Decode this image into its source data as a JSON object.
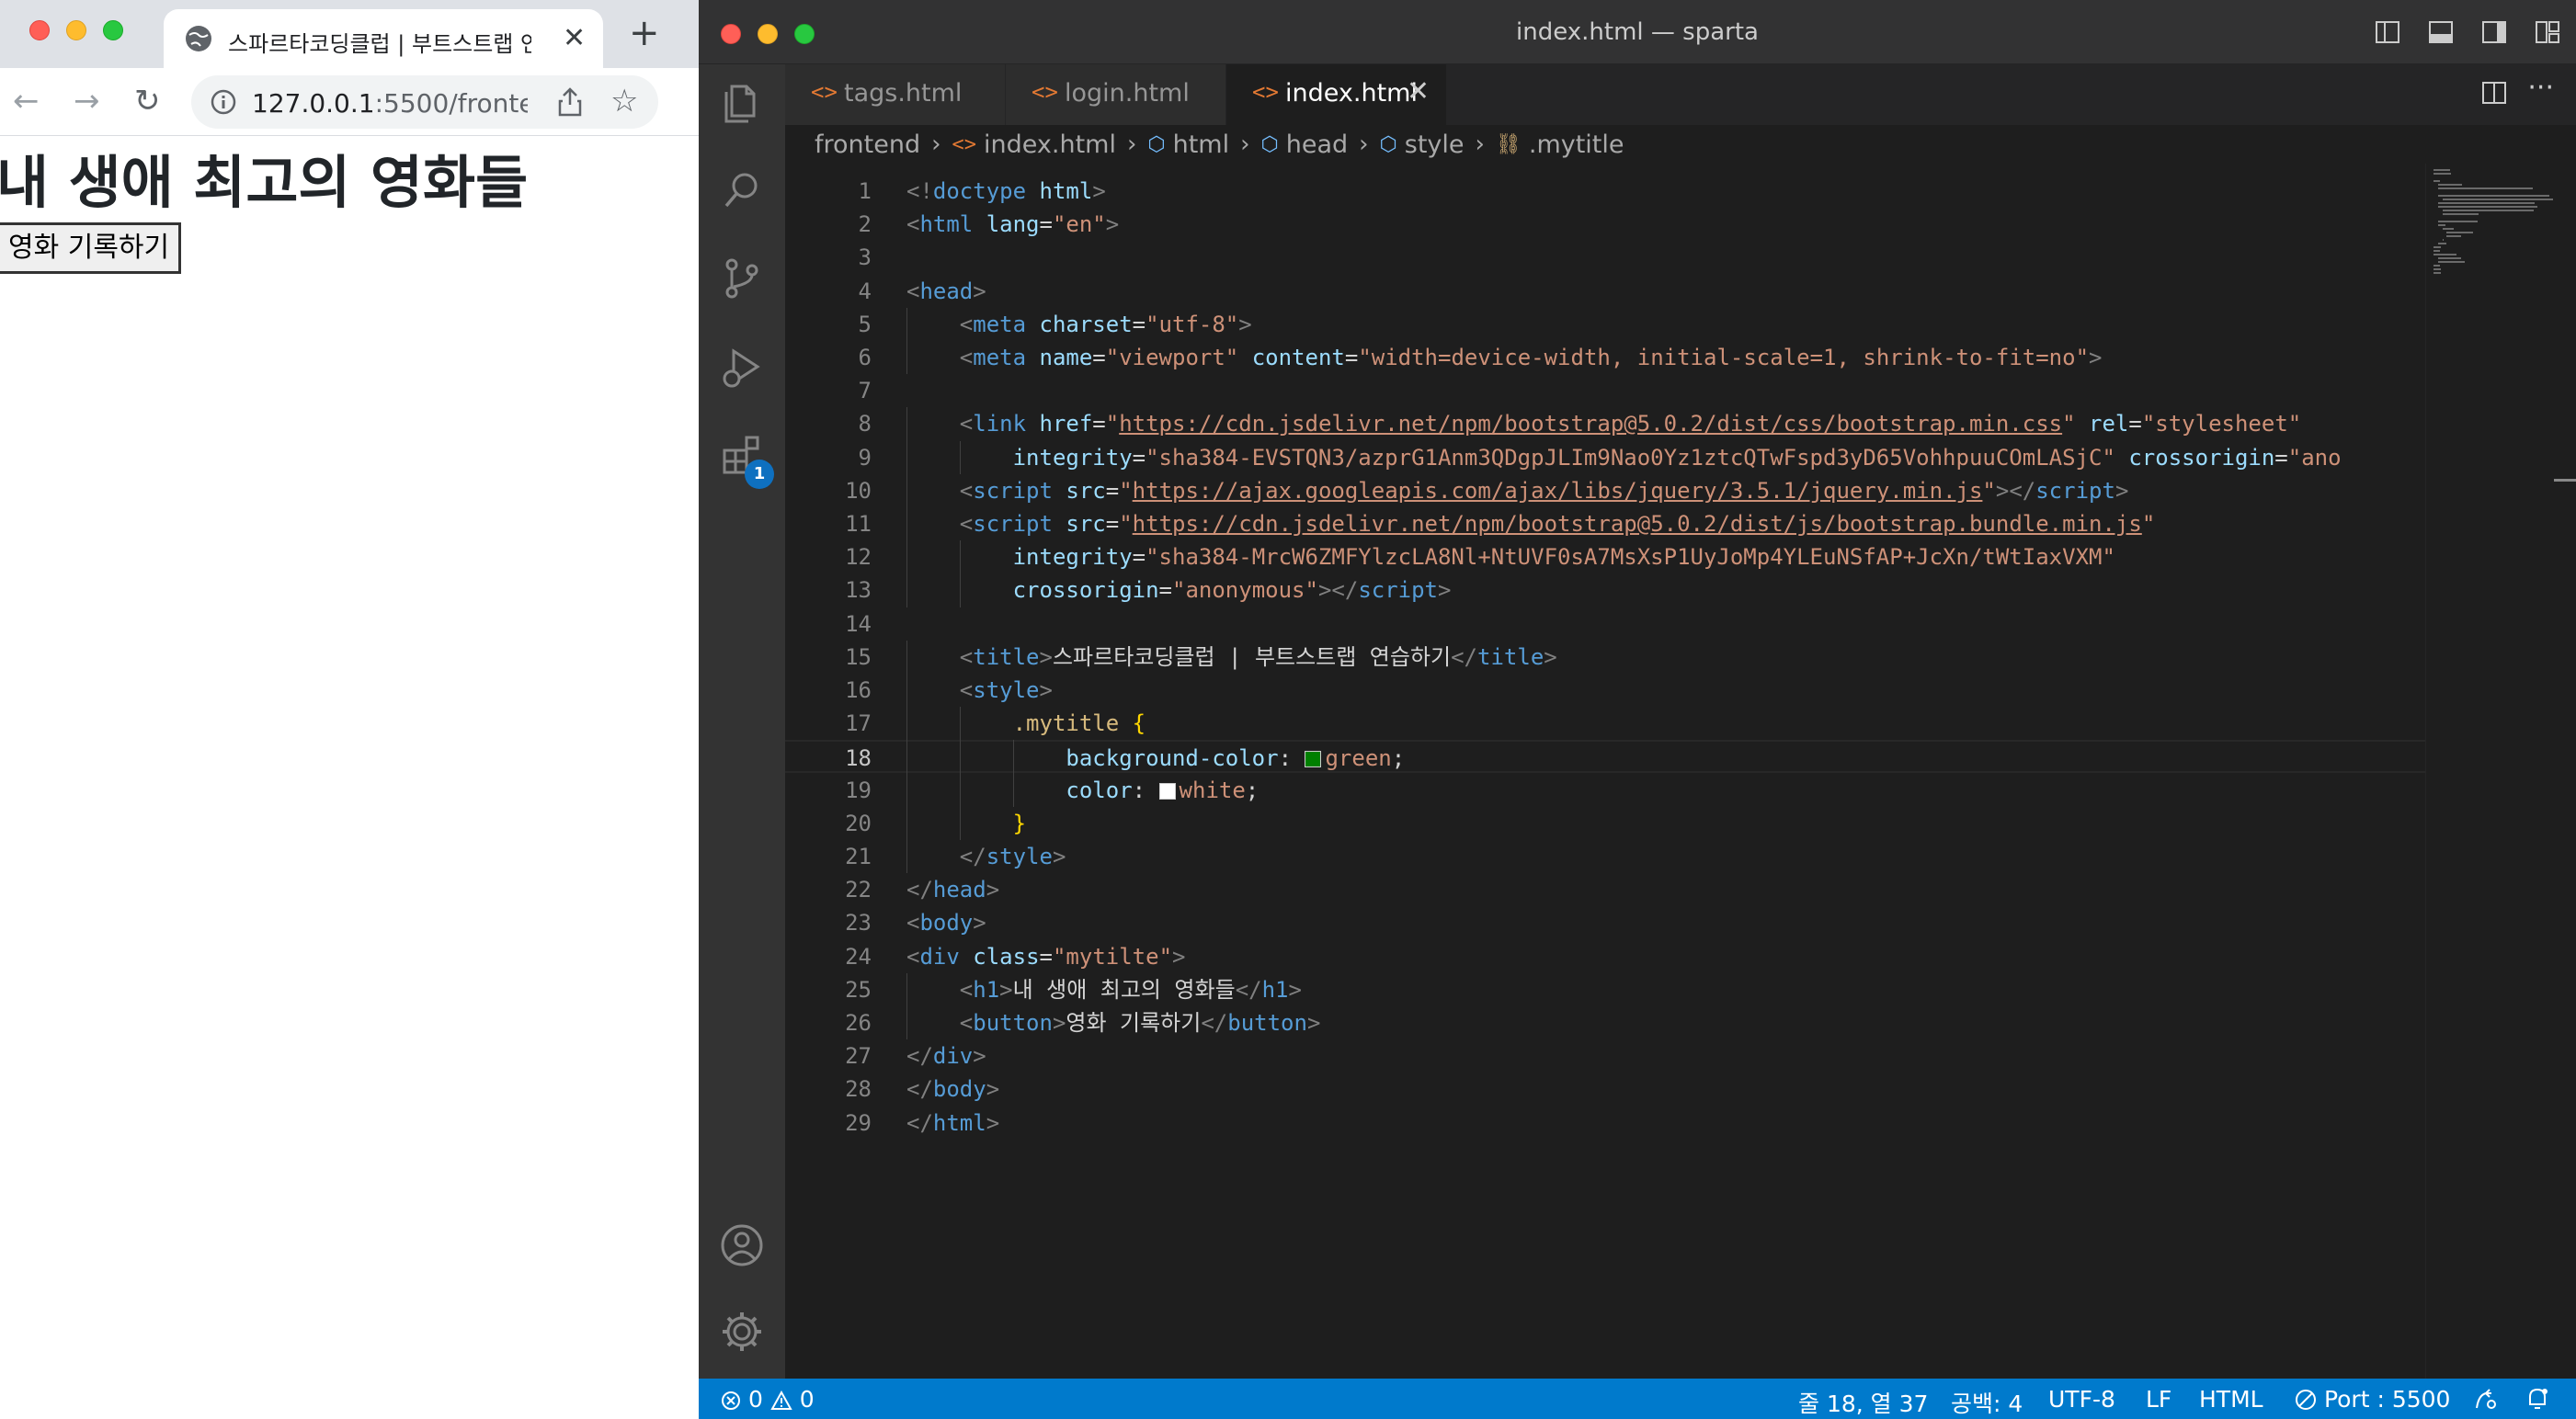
{
  "browser": {
    "tab_title": "스파르타코딩클럽 | 부트스트랩 연습하기",
    "close_glyph": "✕",
    "newtab_glyph": "+",
    "url_host": "127.0.0.1",
    "url_rest": ":5500/fronte...",
    "nav": {
      "back": "←",
      "forward": "→",
      "reload": "↻"
    },
    "star_glyph": "☆",
    "page": {
      "h1": "내 생애 최고의 영화들",
      "button": "영화 기록하기"
    }
  },
  "vscode": {
    "window_title": "index.html — sparta",
    "tabs": [
      {
        "label": "tags.html",
        "icon": "<>"
      },
      {
        "label": "login.html",
        "icon": "<>"
      },
      {
        "label": "index.html",
        "icon": "<>",
        "close": "✕"
      }
    ],
    "more_glyph": "···",
    "breadcrumbs": [
      {
        "label": "frontend",
        "icon": ""
      },
      {
        "label": "index.html",
        "icon": "<>"
      },
      {
        "label": "html",
        "icon": "⬡"
      },
      {
        "label": "head",
        "icon": "⬡"
      },
      {
        "label": "style",
        "icon": "⬡"
      },
      {
        "label": ".mytitle",
        "icon": "⛓"
      }
    ],
    "breadcrumb_sep": "›",
    "extensions_badge": "1",
    "current_line": 18,
    "line_numbers": [
      "1",
      "2",
      "3",
      "4",
      "5",
      "6",
      "7",
      "8",
      "9",
      "10",
      "11",
      "12",
      "13",
      "14",
      "15",
      "16",
      "17",
      "18",
      "19",
      "20",
      "21",
      "22",
      "23",
      "24",
      "25",
      "26",
      "27",
      "28",
      "29"
    ],
    "code": {
      "l1": [
        "<!",
        "doctype",
        " ",
        "html",
        ">"
      ],
      "l2": [
        "<",
        "html",
        " ",
        "lang",
        "=",
        "\"en\"",
        ">"
      ],
      "l4": [
        "<",
        "head",
        ">"
      ],
      "l5": [
        "<",
        "meta",
        " ",
        "charset",
        "=",
        "\"utf-8\"",
        ">"
      ],
      "l6": [
        "<",
        "meta",
        " ",
        "name",
        "=",
        "\"viewport\"",
        " ",
        "content",
        "=",
        "\"width=device-width, initial-scale=1, shrink-to-fit=no\"",
        ">"
      ],
      "l8": [
        "<",
        "link",
        " ",
        "href",
        "=",
        "\"",
        "https://cdn.jsdelivr.net/npm/bootstrap@5.0.2/dist/css/bootstrap.min.css",
        "\"",
        " ",
        "rel",
        "=",
        "\"stylesheet\""
      ],
      "l9": [
        "integrity",
        "=",
        "\"sha384-EVSTQN3/azprG1Anm3QDgpJLIm9Nao0Yz1ztcQTwFspd3yD65VohhpuuCOmLASjC\"",
        " ",
        "crossorigin",
        "=",
        "\"ano"
      ],
      "l10": [
        "<",
        "script",
        " ",
        "src",
        "=",
        "\"",
        "https://ajax.googleapis.com/ajax/libs/jquery/3.5.1/jquery.min.js",
        "\"",
        "></",
        "script",
        ">"
      ],
      "l11": [
        "<",
        "script",
        " ",
        "src",
        "=",
        "\"",
        "https://cdn.jsdelivr.net/npm/bootstrap@5.0.2/dist/js/bootstrap.bundle.min.js",
        "\""
      ],
      "l12": [
        "integrity",
        "=",
        "\"sha384-MrcW6ZMFYlzcLA8Nl+NtUVF0sA7MsXsP1UyJoMp4YLEuNSfAP+JcXn/tWtIaxVXM\""
      ],
      "l13": [
        "crossorigin",
        "=",
        "\"anonymous\"",
        "></",
        "script",
        ">"
      ],
      "l15": [
        "<",
        "title",
        ">",
        "스파르타코딩클럽 | 부트스트랩 연습하기",
        "</",
        "title",
        ">"
      ],
      "l16": [
        "<",
        "style",
        ">"
      ],
      "l17": [
        ".mytitle",
        " ",
        "{"
      ],
      "l18": [
        "background-color",
        ": ",
        "green",
        ";"
      ],
      "l19": [
        "color",
        ": ",
        "white",
        ";"
      ],
      "l20": [
        "}"
      ],
      "l21": [
        "</",
        "style",
        ">"
      ],
      "l22": [
        "</",
        "head",
        ">"
      ],
      "l23": [
        "<",
        "body",
        ">"
      ],
      "l24": [
        "<",
        "div",
        " ",
        "class",
        "=",
        "\"mytilte\"",
        ">"
      ],
      "l25": [
        "<",
        "h1",
        ">",
        "내 생애 최고의 영화들",
        "</",
        "h1",
        ">"
      ],
      "l26": [
        "<",
        "button",
        ">",
        "영화 기록하기",
        "</",
        "button",
        ">"
      ],
      "l27": [
        "</",
        "div",
        ">"
      ],
      "l28": [
        "</",
        "body",
        ">"
      ],
      "l29": [
        "</",
        "html",
        ">"
      ]
    },
    "swatches": {
      "green": "#008000",
      "white": "#ffffff"
    },
    "status": {
      "errors": "0",
      "warnings": "0",
      "position": "줄 18, 열 37",
      "spaces": "공백: 4",
      "encoding": "UTF-8",
      "eol": "LF",
      "language": "HTML",
      "port": "Port : 5500"
    }
  },
  "colors": {
    "status_blue": "#007acc",
    "editor_bg": "#1e1e1e",
    "tag_blue": "#569cd6",
    "attr_cyan": "#9cdcfe",
    "string_orange": "#ce9178",
    "html_icon_orange": "#e37933"
  }
}
